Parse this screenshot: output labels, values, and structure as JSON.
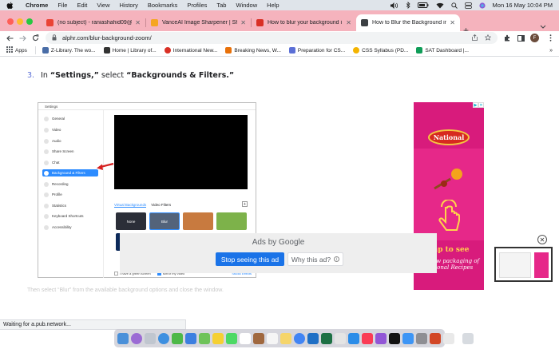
{
  "menubar": {
    "app_name": "Chrome",
    "items": [
      "File",
      "Edit",
      "View",
      "History",
      "Bookmarks",
      "Profiles",
      "Tab",
      "Window",
      "Help"
    ],
    "datetime": "Mon 16 May  10:04 PM"
  },
  "tabs": [
    {
      "title": "(no subject) - raniashahid09@",
      "favicon_color": "#ea4335"
    },
    {
      "title": "VanceAI Image Sharpener | Sh",
      "favicon_color": "#f5a623"
    },
    {
      "title": "How to blur your background i",
      "favicon_color": "#d93025"
    },
    {
      "title": "How to Blur the Background in",
      "favicon_color": "#3c4043",
      "active": true
    }
  ],
  "toolbar": {
    "url": "alphr.com/blur-background-zoom/",
    "profile_initial": "F"
  },
  "bookmarks": [
    {
      "label": "Apps",
      "color": "#5f6368"
    },
    {
      "label": "Z-Library. The wo...",
      "color": "#4a6da7"
    },
    {
      "label": "Home | Library of...",
      "color": "#333333"
    },
    {
      "label": "International New...",
      "color": "#d93025"
    },
    {
      "label": "Breaking News, W...",
      "color": "#e8710a"
    },
    {
      "label": "Preparation for CS...",
      "color": "#5b6fd6"
    },
    {
      "label": "CSS Syllabus (PD...",
      "color": "#f4b400"
    },
    {
      "label": "SAT Dashboard |...",
      "color": "#0f9d58"
    }
  ],
  "article": {
    "step_number": "3.",
    "step_prefix": "In ",
    "step_bold_1": "“Settings,”",
    "step_middle": " select ",
    "step_bold_2": "“Backgrounds & Filters.”",
    "faded_text": "Then select “Blur” from the available background options and close the window."
  },
  "zoom_settings": {
    "window_title": "Settings",
    "sidebar": [
      "General",
      "Video",
      "Audio",
      "Share Screen",
      "Chat",
      "Background & Filters",
      "Recording",
      "Profile",
      "Statistics",
      "Keyboard Shortcuts",
      "Accessibility"
    ],
    "active_item": "Background & Filters",
    "tabs": [
      "Virtual Backgrounds",
      "Video Filters"
    ],
    "backgrounds": [
      "None",
      "Blur"
    ],
    "green_screen_label": "I have a green screen",
    "mirror_label": "Mirror my video",
    "studio_effects": "Studio Effects"
  },
  "ad": {
    "brand": "National",
    "cta": "Tap to see",
    "sub": "the new packaging of National Recipes"
  },
  "google_ads": {
    "label": "Ads by Google",
    "stop_label": "Stop seeing this ad",
    "why_label": "Why this ad?"
  },
  "status": {
    "text": "Waiting for a.pub.network..."
  },
  "colors": {
    "tab_strip": "#f5b3bd",
    "zoom_accent": "#2d8cff",
    "ad_pink": "#e62889",
    "google_blue": "#1a73e8"
  }
}
